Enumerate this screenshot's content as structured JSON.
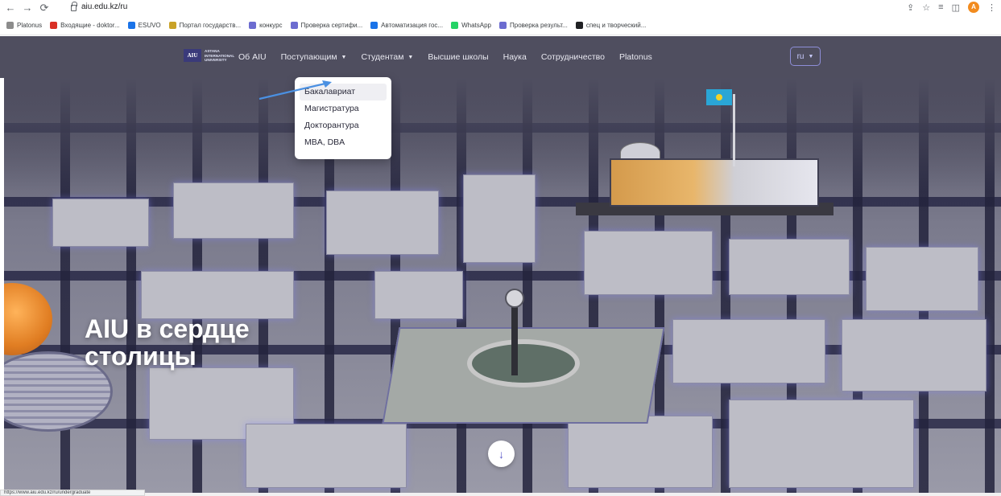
{
  "browser": {
    "url": "aiu.edu.kz/ru",
    "status_url": "https://www.aiu.edu.kz/ru/undergraduate",
    "profile_initial": "A",
    "bookmarks": [
      {
        "label": "Platonus",
        "icon": "grid-icon",
        "color": "#8c8c8c"
      },
      {
        "label": "Входящие - doktor...",
        "icon": "gmail-icon",
        "color": "#d93025"
      },
      {
        "label": "ESUVO",
        "icon": "esuvo-icon",
        "color": "#1a73e8"
      },
      {
        "label": "Портал государств...",
        "icon": "gov-portal-icon",
        "color": "#c9a227"
      },
      {
        "label": "конкурс",
        "icon": "uni-icon",
        "color": "#6c6cd0"
      },
      {
        "label": "Проверка сертифи...",
        "icon": "uni-icon",
        "color": "#6c6cd0"
      },
      {
        "label": "Автоматизация гос...",
        "icon": "automation-icon",
        "color": "#1a73e8"
      },
      {
        "label": "WhatsApp",
        "icon": "whatsapp-icon",
        "color": "#25d366"
      },
      {
        "label": "Проверка результ...",
        "icon": "uni-icon",
        "color": "#6c6cd0"
      },
      {
        "label": "спец и творческий...",
        "icon": "dark-badge-icon",
        "color": "#202124"
      }
    ]
  },
  "header": {
    "logo_box": "AIU",
    "logo_lines": [
      "ASTANA",
      "INTERNATIONAL",
      "UNIVERSITY"
    ],
    "nav": [
      {
        "label": "Об AIU",
        "dropdown": false
      },
      {
        "label": "Поступающим",
        "dropdown": true
      },
      {
        "label": "Студентам",
        "dropdown": true
      },
      {
        "label": "Высшие школы",
        "dropdown": false
      },
      {
        "label": "Наука",
        "dropdown": false
      },
      {
        "label": "Сотрудничество",
        "dropdown": false
      },
      {
        "label": "Platonus",
        "dropdown": false
      }
    ],
    "language": "ru"
  },
  "dropdown": {
    "items": [
      "Бакалавриат",
      "Магистратура",
      "Докторантура",
      "MBA, DBA"
    ],
    "highlighted": "Бакалавриат"
  },
  "hero": {
    "title_line1": "AIU в сердце",
    "title_line2": "столицы",
    "scroll_icon": "arrow-down-icon"
  },
  "colors": {
    "header_bg": "#4f4e5f",
    "accent": "#5a58c8",
    "annotation_arrow": "#4a90e2"
  }
}
